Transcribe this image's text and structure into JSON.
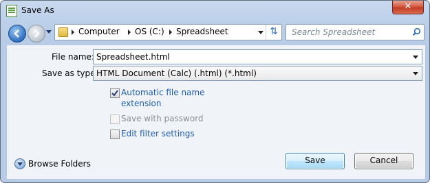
{
  "window": {
    "title": "Save As",
    "close_glyph": "✕"
  },
  "nav": {
    "breadcrumbs": [
      "Computer",
      "OS (C:)",
      "Spreadsheet"
    ],
    "refresh_glyph": "⇅",
    "search_placeholder": "Search Spreadsheet"
  },
  "form": {
    "file_name_label": "File name:",
    "file_name_value": "Spreadsheet.html",
    "save_as_type_label": "Save as type:",
    "save_as_type_value": "HTML Document (Calc) (.html) (*.html)"
  },
  "options": {
    "auto_ext_line1": "Automatic file name",
    "auto_ext_line2": "extension",
    "auto_ext_checked": true,
    "password_label": "Save with password",
    "password_checked": false,
    "password_enabled": false,
    "filter_label": "Edit filter settings",
    "filter_checked": false
  },
  "footer": {
    "browse_folders": "Browse Folders",
    "save_button": "Save",
    "cancel_button": "Cancel"
  },
  "colors": {
    "link": "#1f5cb6",
    "close_button": "#c23a22",
    "window_frame": "#b7cbe6"
  },
  "icons": [
    "spreadsheet-icon",
    "close-icon",
    "back-icon",
    "forward-icon",
    "folder-icon",
    "refresh-icon",
    "search-icon",
    "chevron-down-icon",
    "check-icon"
  ]
}
